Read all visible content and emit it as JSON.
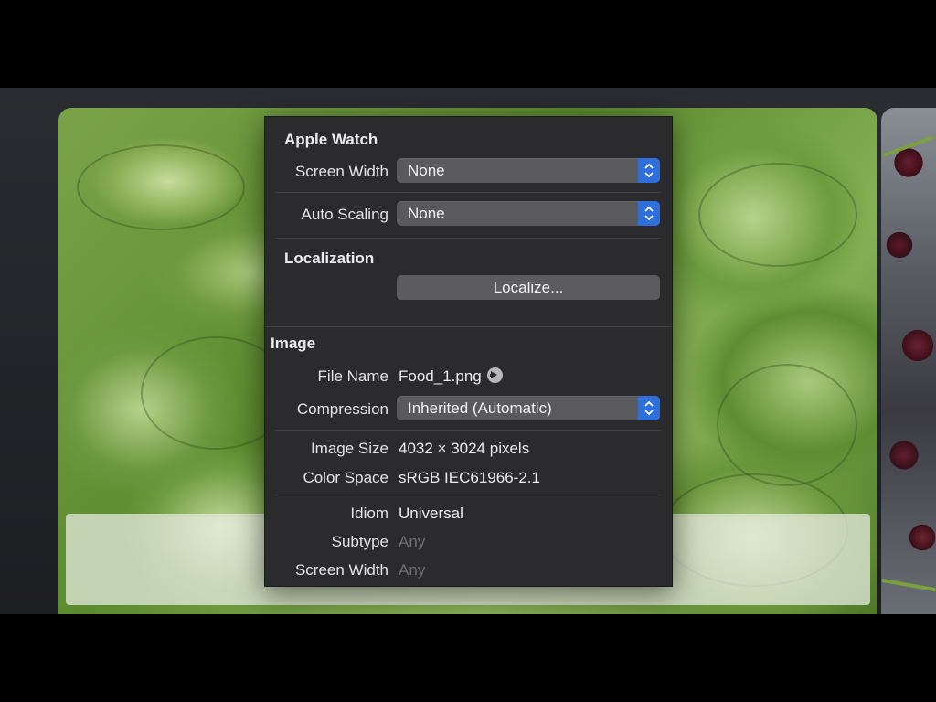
{
  "inspector": {
    "apple_watch": {
      "title": "Apple Watch",
      "screen_width_label": "Screen Width",
      "screen_width_value": "None",
      "auto_scaling_label": "Auto Scaling",
      "auto_scaling_value": "None"
    },
    "localization": {
      "title": "Localization",
      "button_label": "Localize..."
    },
    "image": {
      "title": "Image",
      "file_name_label": "File Name",
      "file_name_value": "Food_1.png",
      "file_link_icon": "arrow-circle-right-icon",
      "compression_label": "Compression",
      "compression_value": "Inherited (Automatic)",
      "image_size_label": "Image Size",
      "image_size_value": "4032 × 3024 pixels",
      "color_space_label": "Color Space",
      "color_space_value": "sRGB IEC61966-2.1",
      "idiom_label": "Idiom",
      "idiom_value": "Universal",
      "subtype_label": "Subtype",
      "subtype_value": "Any",
      "screen_width_label": "Screen Width",
      "screen_width_value": "Any"
    }
  },
  "colors": {
    "accent": "#2f6fdc",
    "panel_bg": "#2b2b2e",
    "popup_bg": "#5a5a5e",
    "dim_text": "#6f6f73"
  }
}
